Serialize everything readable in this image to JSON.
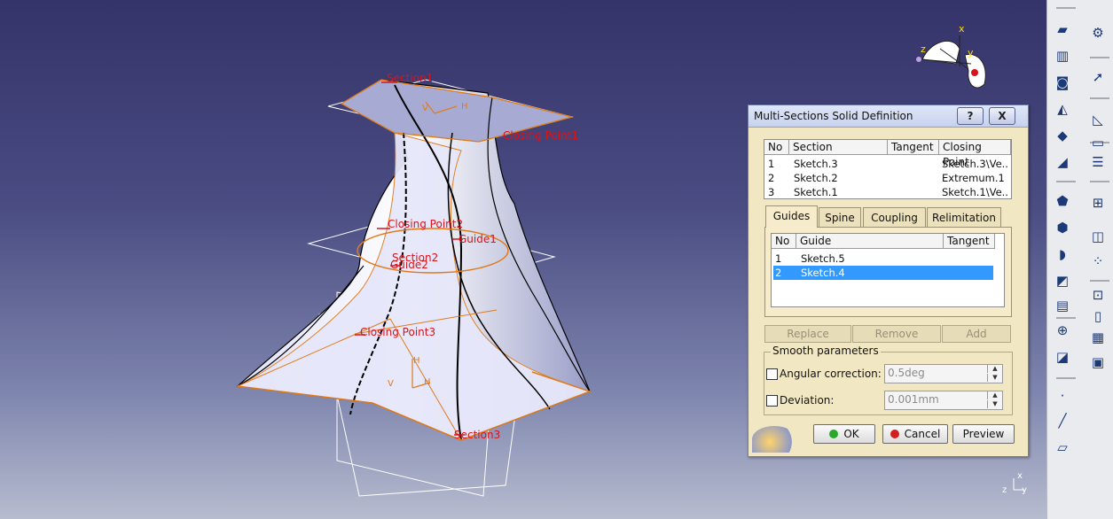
{
  "labels": {
    "section1": "Section1",
    "closing_point1": "Closing Point1",
    "closing_point2": "Closing Point2",
    "guide1": "Guide1",
    "section2": "Section2",
    "guide2": "Guide2",
    "closing_point3": "Closing Point3",
    "section3": "Section3",
    "axis_h1": "H",
    "axis_v1": "V",
    "axis_h2": "H",
    "axis_h3": "H",
    "axis_v3": "V",
    "compass_x": "x",
    "compass_y": "y",
    "compass_z": "z",
    "corner_z": "z",
    "corner_x": "x",
    "corner_y": "y"
  },
  "dialog": {
    "title": "Multi-Sections Solid Definition",
    "help_label": "?",
    "close_label": "X",
    "sections": {
      "headers": [
        "No",
        "Section",
        "Tangent",
        "Closing Point"
      ],
      "rows": [
        {
          "no": "1",
          "section": "Sketch.3",
          "tangent": "",
          "closing_point": "Sketch.3\\Ve..."
        },
        {
          "no": "2",
          "section": "Sketch.2",
          "tangent": "",
          "closing_point": "Extremum.1"
        },
        {
          "no": "3",
          "section": "Sketch.1",
          "tangent": "",
          "closing_point": "Sketch.1\\Ve..."
        }
      ]
    },
    "tabs": [
      "Guides",
      "Spine",
      "Coupling",
      "Relimitation"
    ],
    "active_tab": "Guides",
    "guides": {
      "headers": [
        "No",
        "Guide",
        "Tangent"
      ],
      "rows": [
        {
          "no": "1",
          "guide": "Sketch.5",
          "tangent": ""
        },
        {
          "no": "2",
          "guide": "Sketch.4",
          "tangent": ""
        }
      ],
      "selected_row": 2
    },
    "guide_buttons": {
      "replace": "Replace",
      "remove": "Remove",
      "add": "Add"
    },
    "smooth": {
      "group_label": "Smooth parameters",
      "angular_label": "Angular correction:",
      "angular_value": "0.5deg",
      "deviation_label": "Deviation:",
      "deviation_value": "0.001mm"
    },
    "buttons": {
      "ok": "OK",
      "cancel": "Cancel",
      "preview": "Preview"
    }
  },
  "colors": {
    "label_red": "#d8141a",
    "wire_orange": "#e07b1c",
    "selection_blue": "#3399ff",
    "dialog_bg": "#f2e7c3"
  },
  "toolbar_icons": [
    "pad-icon",
    "pocket-icon",
    "shaft-icon",
    "groove-icon",
    "hole-icon",
    "rib-icon",
    "slot-icon",
    "stiffener-icon",
    "multi-sections-solid-icon",
    "removed-multi-sections-icon",
    "fillet-icon",
    "chamfer-icon",
    "draft-icon",
    "shell-icon",
    "thickness-icon",
    "thread-icon",
    "point-icon",
    "line-icon",
    "plane-icon",
    "transform-icon",
    "select-icon",
    "sketcher-icon",
    "measure-icon",
    "surface-icon",
    "grid-icon",
    "analysis-icon",
    "mirror-icon",
    "pattern-icon"
  ]
}
